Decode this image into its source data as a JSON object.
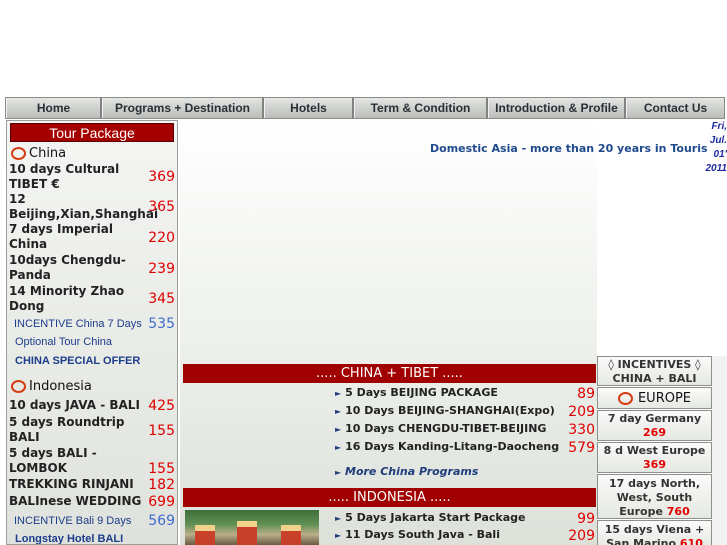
{
  "nav": [
    "Home",
    "Programs + Destination",
    "Hotels",
    "Term & Condition",
    "Introduction & Profile",
    "Contact Us"
  ],
  "sidebar": {
    "heading": "Tour Package",
    "china": {
      "label": "China",
      "tours": [
        {
          "name": "10 days Cultural TIBET €",
          "price": "369"
        },
        {
          "name": "12 Beijing,Xian,Shanghai",
          "price": "365"
        },
        {
          "name": "7 days Imperial China",
          "price": "220"
        },
        {
          "name": "10days Chengdu-Panda",
          "price": "239"
        },
        {
          "name": "14 Minority Zhao Dong",
          "price": "345"
        }
      ],
      "incentive": {
        "label": "INCENTIVE China 7 Days",
        "price": "535"
      },
      "optional": "Optional Tour China",
      "special": "CHINA SPECIAL OFFER"
    },
    "indonesia": {
      "label": "Indonesia",
      "tours": [
        {
          "name": "10 days JAVA - BALI",
          "price": "425"
        },
        {
          "name": "5 days Roundtrip BALI",
          "price": "155"
        },
        {
          "name": "5 days BALI - LOMBOK",
          "price": "155"
        },
        {
          "name": "TREKKING RINJANI",
          "price": "182"
        },
        {
          "name": "BALInese WEDDING",
          "price": "699"
        }
      ],
      "incentive": {
        "label": "INCENTIVE Bali 9 Days",
        "price": "569"
      },
      "hotel": "Longstay Hotel BALI"
    }
  },
  "tagline": "Domestic Asia - more than 20 years in Touris",
  "date": [
    "Fri,",
    "Jul.",
    "01'",
    "2011"
  ],
  "china_tibet": {
    "title": "..... CHINA + TIBET .....",
    "programs": [
      {
        "name": "5 Days BEIJING PACKAGE",
        "price": "89"
      },
      {
        "name": "10 Days BEIJING-SHANGHAI(Expo)",
        "price": "209"
      },
      {
        "name": "10 Days CHENGDU-TIBET-BEIJING",
        "price": "330"
      },
      {
        "name": "16 Days Kanding-Litang-Daocheng",
        "price": "579"
      }
    ],
    "more": "More China Programs"
  },
  "indonesia_sec": {
    "title": "..... INDONESIA .....",
    "programs": [
      {
        "name": "5 Days Jakarta Start Package",
        "price": "99"
      },
      {
        "name": "11 Days South Java - Bali",
        "price": "209"
      }
    ]
  },
  "right": {
    "incentives": "◊ INCENTIVES ◊ CHINA + BALI",
    "europe": "EUROPE",
    "items": [
      {
        "name": "7 day Germany",
        "price": "269"
      },
      {
        "name": "8 d West Europe",
        "price": "369"
      },
      {
        "name": "17 days North, West, South Europe",
        "price": "760"
      },
      {
        "name": "15 days Viena + San Marino",
        "price": "610"
      }
    ]
  },
  "colors": {
    "accent_red": "#a00000",
    "price_red": "#e00000",
    "link_blue": "#1c3c8c"
  }
}
